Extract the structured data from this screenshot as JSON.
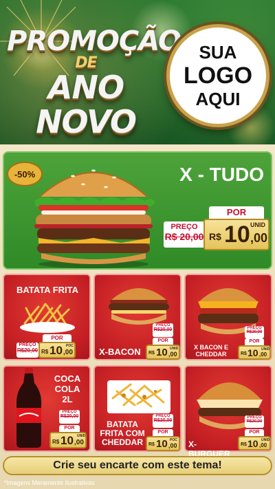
{
  "headline": {
    "line1": "PROMOÇÃO",
    "line2": "DE",
    "line3": "ANO NOVO"
  },
  "logo": {
    "line1": "SUA",
    "line2": "LOGO",
    "line3": "AQUI"
  },
  "featured": {
    "title": "X - TUDO",
    "discount": "-50%",
    "old_label": "PREÇO",
    "old_value": "R$ 20,00",
    "por": "POR",
    "currency": "R$",
    "price_int": "10",
    "price_dec": ",00",
    "unit": "UNID"
  },
  "products": [
    {
      "name": "BATATA FRITA",
      "old_label": "PREÇO",
      "old_value": "R$20,00",
      "por": "POR",
      "currency": "R$",
      "price_int": "10",
      "price_dec": ",00",
      "unit": "POC"
    },
    {
      "name": "X-BACON",
      "old_label": "PREÇO",
      "old_value": "R$20,00",
      "por": "POR",
      "currency": "R$",
      "price_int": "10",
      "price_dec": ",00",
      "unit": "UNID"
    },
    {
      "name": "X BACON E CHEDDAR",
      "old_label": "PREÇO",
      "old_value": "R$20,00",
      "por": "POR",
      "currency": "R$",
      "price_int": "10",
      "price_dec": ",00",
      "unit": "UNID"
    },
    {
      "name": "COCA COLA 2L",
      "old_label": "PREÇO",
      "old_value": "R$20,00",
      "por": "POR",
      "currency": "R$",
      "price_int": "10",
      "price_dec": ",00",
      "unit": "UNID"
    },
    {
      "name": "BATATA FRITA COM CHEDDAR",
      "old_label": "PREÇO",
      "old_value": "R$20,00",
      "por": "POR",
      "currency": "R$",
      "price_int": "10",
      "price_dec": ",00",
      "unit": "POC"
    },
    {
      "name": "X-BURGUER",
      "old_label": "PREÇO",
      "old_value": "R$20,00",
      "por": "POR",
      "currency": "R$",
      "price_int": "10",
      "price_dec": ",00",
      "unit": "UNID"
    }
  ],
  "cta": "Crie seu encarte com este tema!",
  "disclaimer": "*Imagens Meramente Ilustrativas",
  "colors": {
    "red": "#c41f24",
    "green": "#3a9a30",
    "gold": "#e4c45a",
    "cream": "#f3e7c9"
  }
}
